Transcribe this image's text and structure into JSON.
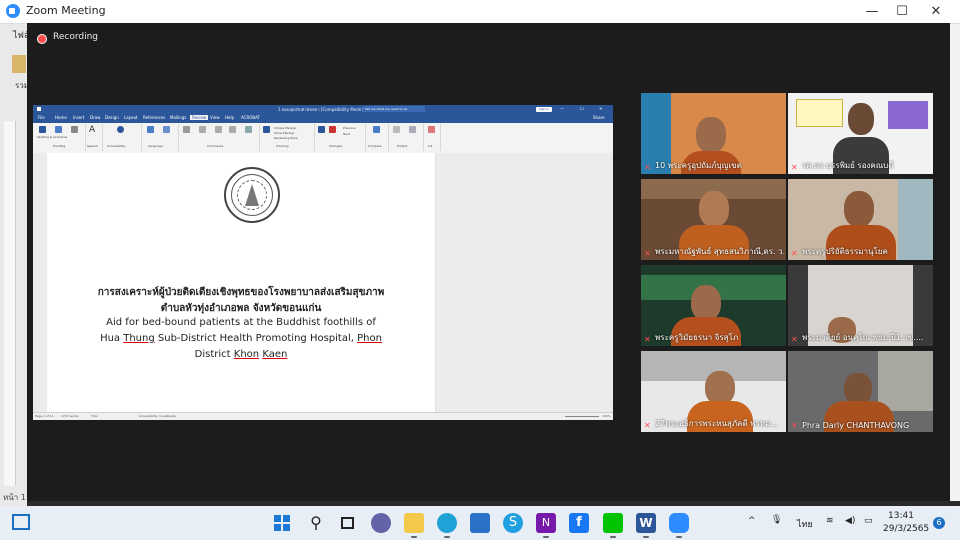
{
  "zoom": {
    "window_title": "Zoom Meeting",
    "recording_label": "Recording",
    "controls": {
      "minimize": "—",
      "maximize": "☐",
      "close": "✕"
    }
  },
  "background_window": {
    "menu_fragment": "ไฟล์",
    "side_fragment": "รวม",
    "bottom_fragment": "หน้า 1"
  },
  "word": {
    "title": "1 ตอบสุดปรับตัวนัขขขา  [Compatibility Mode]  -  Word",
    "search": "Tell me what you want to do",
    "sign_in": "Sign in",
    "share": "Share",
    "tabs": [
      "File",
      "Home",
      "Insert",
      "Draw",
      "Design",
      "Layout",
      "References",
      "Mailings",
      "Review",
      "View",
      "Help",
      "ACROBAT"
    ],
    "active_tab": "Review",
    "ribbon_groups": [
      {
        "name": "Proofing",
        "buttons": [
          "Spelling & Grammar",
          "Thesaurus",
          "Word Count"
        ]
      },
      {
        "name": "Speech",
        "buttons": [
          "Read Aloud"
        ]
      },
      {
        "name": "Accessibility",
        "buttons": [
          "Check Accessibility"
        ]
      },
      {
        "name": "Language",
        "buttons": [
          "Translate",
          "Language"
        ]
      },
      {
        "name": "Comments",
        "buttons": [
          "New Comment",
          "Delete",
          "Previous",
          "Next",
          "Show Comments"
        ]
      },
      {
        "name": "Tracking",
        "buttons": [
          "Track Changes",
          "Simple Markup",
          "Show Markup",
          "Reviewing Pane"
        ]
      },
      {
        "name": "Changes",
        "buttons": [
          "Accept",
          "Reject",
          "Previous",
          "Next"
        ]
      },
      {
        "name": "Compare",
        "buttons": [
          "Compare"
        ]
      },
      {
        "name": "Protect",
        "buttons": [
          "Block Authors",
          "Restrict Editing"
        ]
      },
      {
        "name": "Ink",
        "buttons": [
          "Hide Ink"
        ]
      }
    ],
    "doc": {
      "thai_line1": "การสงเคราะห์ผู้ป่วยติดเตียงเชิงพุทธของโรงพยาบาลส่งเสริมสุขภาพ",
      "thai_line2": "ตำบลหัวทุ่งอำเภอพล จังหวัดขอนแก่น",
      "en_line1": "Aid for bed-bound patients at the Buddhist foothills of",
      "en_line2_a": "Hua ",
      "en_line2_b": "Thung",
      "en_line2_c": " Sub-District Health Promoting Hospital, ",
      "en_line2_d": "Phon",
      "en_line3_a": "District ",
      "en_line3_b": "Khon",
      "en_line3_c": " ",
      "en_line3_d": "Kaen"
    },
    "status": {
      "page": "Page 1 of 11",
      "words": "1713 words",
      "language": "Thai",
      "accessibility": "Accessibility: Investigate",
      "zoom": "100%"
    }
  },
  "participants": [
    {
      "name": "10 พระครูอุปถัมภ์บุญเขต",
      "bg": "#d98a4a",
      "active": false
    },
    {
      "name": "รศ.ดร.บรรพิมย์ รองคณบดี",
      "bg": "#f2f2f2",
      "active": true
    },
    {
      "name": "พระมหาณัฐพันธ์ สุทธสนวิภาณี,ดร. ว...",
      "bg": "#6b4a35",
      "active": false
    },
    {
      "name": "พระครูปริยัติธรรมานุโยค",
      "bg": "#c9b8a6",
      "active": false
    },
    {
      "name": "พระครูวิมัยธรนา จิรสุโภ",
      "bg": "#2f5d3a",
      "active": false
    },
    {
      "name": "พระมาติยย์ อนุคุโณ พธม.ปี1.วข....",
      "bg": "#d8d4d0",
      "active": false
    },
    {
      "name": "27พระอธิการพระหนสุภัคดี พรหม...",
      "bg": "#e8e8e8",
      "active": false
    },
    {
      "name": "Phra Darly CHANTHAVONG",
      "bg": "#6a6a6a",
      "active": false
    }
  ],
  "taskbar": {
    "language": "ไทย",
    "time": "13:41",
    "date": "29/3/2565",
    "notification_count": "6",
    "apps": [
      "start-icon",
      "search-icon",
      "task-view-icon",
      "chat-icon",
      "file-explorer-icon",
      "edge-icon",
      "mail-icon",
      "skype-icon",
      "onenote-icon",
      "facebook-icon",
      "line-icon",
      "word-icon",
      "zoom-icon"
    ]
  }
}
